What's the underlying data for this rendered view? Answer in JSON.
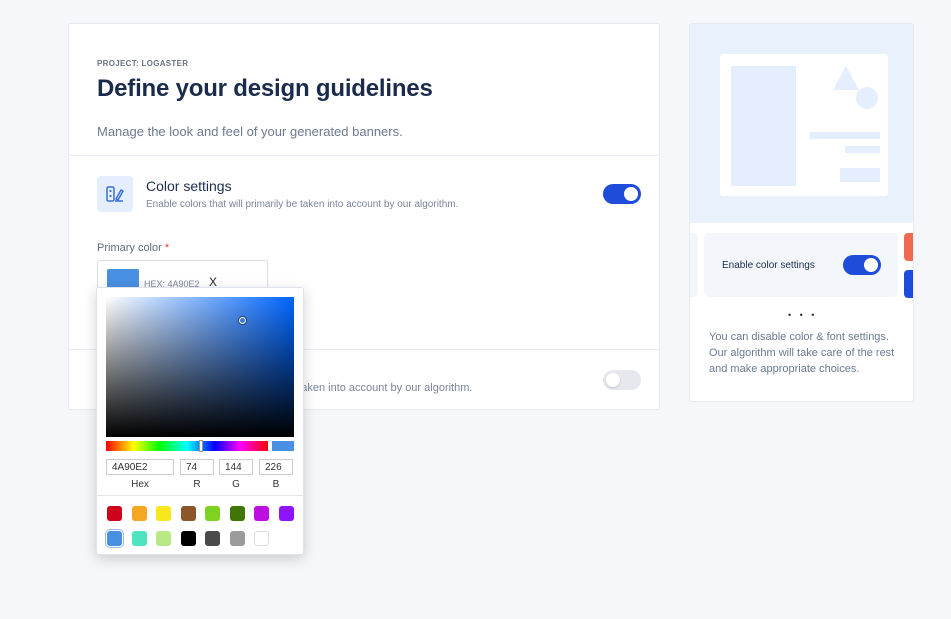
{
  "header": {
    "project": "PROJECT: LOGASTER",
    "title": "Define your design guidelines",
    "subtitle": "Manage the look and feel of your generated banners."
  },
  "color_settings": {
    "title": "Color settings",
    "description": "Enable colors that will primarily be taken into account by our algorithm.",
    "enabled": true,
    "primary_label": "Primary color",
    "required_mark": "*",
    "hex_prefix": "HEX: 4A90E2",
    "clear": "X",
    "primary_hex": "#4a90e2"
  },
  "font_settings": {
    "description_visible": "e taken into account by our algorithm.",
    "enabled": false
  },
  "picker": {
    "hex": "4A90E2",
    "r": "74",
    "g": "144",
    "b": "226",
    "labels": {
      "hex": "Hex",
      "r": "R",
      "g": "G",
      "b": "B"
    },
    "swatches": [
      "#d0021b",
      "#f5a623",
      "#f8e71c",
      "#8b572a",
      "#7ed321",
      "#417505",
      "#bd10e0",
      "#9013fe",
      "#4a90e2",
      "#50e3c2",
      "#b8e986",
      "#000000",
      "#4a4a4a",
      "#9b9b9b",
      "#ffffff"
    ]
  },
  "preview_panel": {
    "slide_label": "Enable color settings",
    "slide_toggle_on": true,
    "dots": "• • •",
    "description": "You can disable color & font settings. Our algorithm will take care of the rest and make appropriate choices."
  }
}
